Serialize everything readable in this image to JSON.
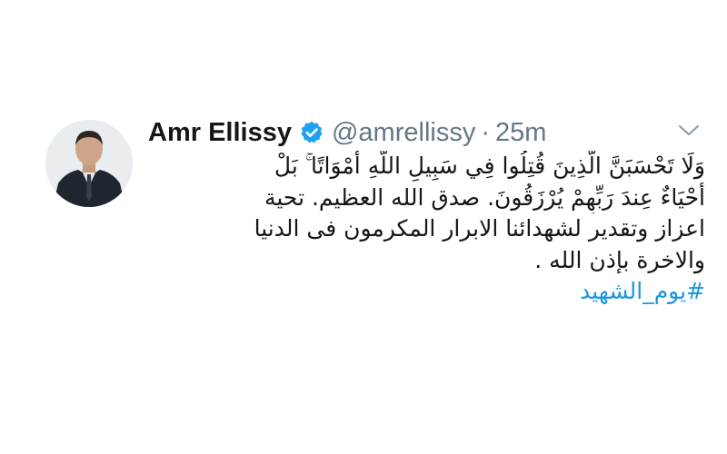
{
  "tweet": {
    "author": {
      "display_name": "Amr Ellissy",
      "handle": "@amrellissy",
      "verified": true
    },
    "separator": "·",
    "timestamp": "25m",
    "body_lines": [
      "وَلَا تَحْسَبَنَّ الَّذِينَ قُتِلُوا فِي سَبِيلِ اللَّهِ أَمْوَاتًا ۚ بَلْ",
      "أَحْيَاءٌ عِندَ رَبِّهِمْ يُرْزَقُونَ. صدق الله العظيم.   تحية",
      "اعزاز وتقدير لشهدائنا الابرار المكرمون فى الدنيا",
      "والاخرة بإذن الله ."
    ],
    "hashtag": "#يوم_الشهيد",
    "icons": {
      "verified": "verified-badge-icon",
      "menu": "chevron-down-icon"
    }
  },
  "colors": {
    "verified_blue": "#1da1f2",
    "hashtag_blue": "#1b95e0",
    "secondary_gray": "#657786",
    "text_dark": "#14171a"
  }
}
